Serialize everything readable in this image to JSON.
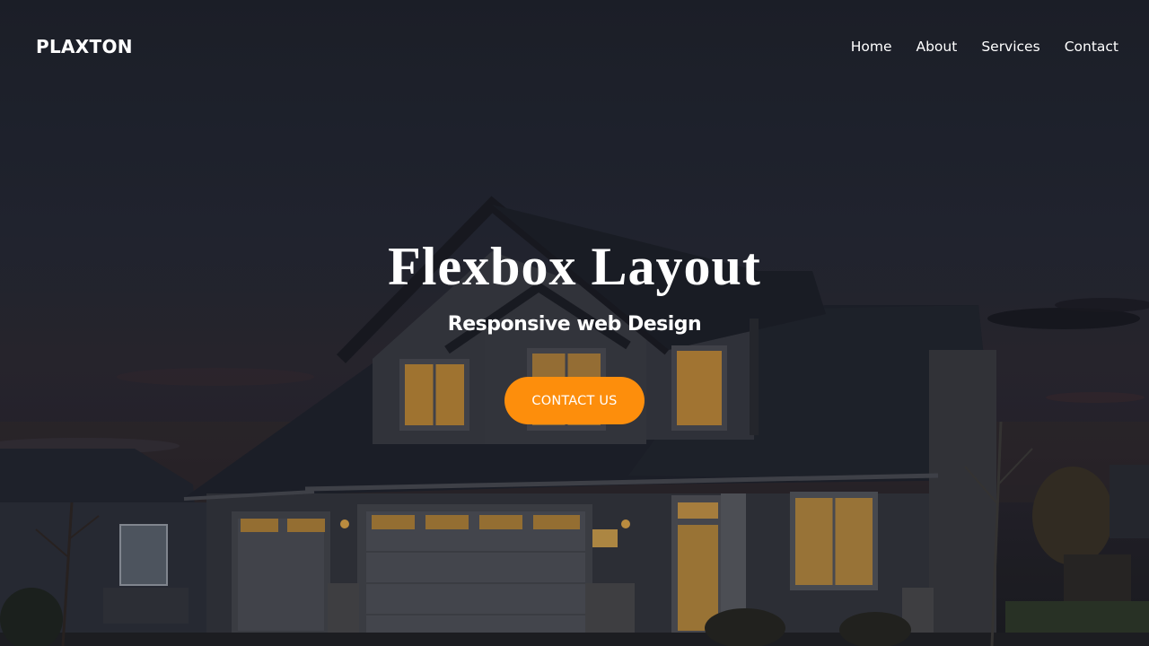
{
  "brand": {
    "logo": "PLAXTON"
  },
  "nav": {
    "items": [
      "Home",
      "About",
      "Services",
      "Contact"
    ]
  },
  "hero": {
    "title": "Flexbox Layout",
    "subtitle": "Responsive web Design",
    "cta_label": "CONTACT US"
  },
  "colors": {
    "accent": "#fd8e0c",
    "text": "#ffffff",
    "sky": "#252935",
    "window_light": "#c88a2c"
  },
  "background": {
    "subject": "house-at-dusk"
  }
}
